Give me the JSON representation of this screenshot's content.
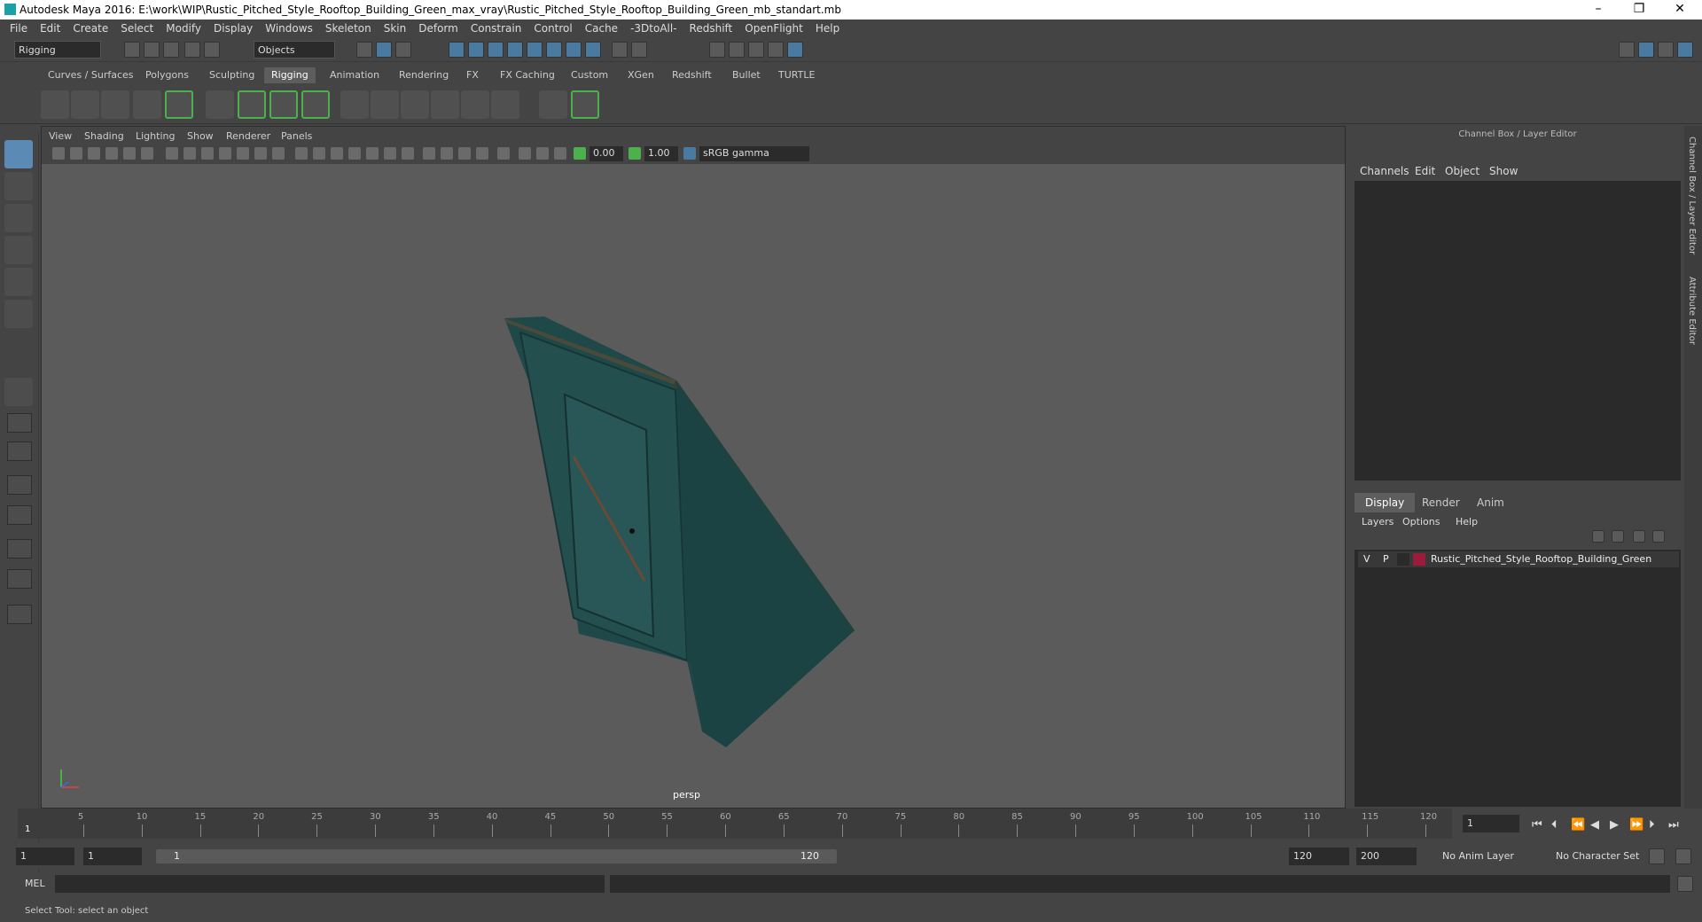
{
  "window": {
    "title": "Autodesk Maya 2016: E:\\work\\WIP\\Rustic_Pitched_Style_Rooftop_Building_Green_max_vray\\Rustic_Pitched_Style_Rooftop_Building_Green_mb_standart.mb",
    "minimize": "–",
    "restore": "❐",
    "close": "✕"
  },
  "menubar": [
    "File",
    "Edit",
    "Create",
    "Select",
    "Modify",
    "Display",
    "Windows",
    "Skeleton",
    "Skin",
    "Deform",
    "Constrain",
    "Control",
    "Cache",
    "-3DtoAll-",
    "Redshift",
    "OpenFlight",
    "Help"
  ],
  "statusline": {
    "mode": "Rigging",
    "selection_mode": "Objects"
  },
  "shelf_tabs": [
    {
      "label": "Curves / Surfaces"
    },
    {
      "label": "Polygons"
    },
    {
      "label": "Sculpting"
    },
    {
      "label": "Rigging",
      "active": true
    },
    {
      "label": "Animation"
    },
    {
      "label": "Rendering"
    },
    {
      "label": "FX"
    },
    {
      "label": "FX Caching"
    },
    {
      "label": "Custom"
    },
    {
      "label": "XGen"
    },
    {
      "label": "Redshift"
    },
    {
      "label": "Bullet"
    },
    {
      "label": "TURTLE"
    }
  ],
  "viewport": {
    "menu": [
      "View",
      "Shading",
      "Lighting",
      "Show",
      "Renderer",
      "Panels"
    ],
    "exposure": "0.00",
    "gamma": "1.00",
    "color_space": "sRGB gamma",
    "camera_label": "persp"
  },
  "channel_box": {
    "title": "Channel Box / Layer Editor",
    "menu": [
      "Channels",
      "Edit",
      "Object",
      "Show"
    ],
    "layer_tabs": [
      "Display",
      "Render",
      "Anim"
    ],
    "layer_menu": [
      "Layers",
      "Options",
      "Help"
    ],
    "layers": [
      {
        "v": "V",
        "p": "P",
        "color": "#9b1c3a",
        "name": "Rustic_Pitched_Style_Rooftop_Building_Green"
      }
    ]
  },
  "side_tabs": [
    "Channel Box / Layer Editor",
    "Attribute Editor"
  ],
  "timeline": {
    "ticks": [
      "5",
      "10",
      "15",
      "20",
      "25",
      "30",
      "35",
      "40",
      "45",
      "50",
      "55",
      "60",
      "65",
      "70",
      "75",
      "80",
      "85",
      "90",
      "95",
      "100",
      "105",
      "110",
      "115",
      "120"
    ],
    "start_label": "1",
    "current_frame": "1"
  },
  "range": {
    "start": "1",
    "playback_start": "1",
    "slider_start": "1",
    "slider_end": "120",
    "playback_end": "120",
    "end": "200",
    "anim_layer": "No Anim Layer",
    "character_set": "No Character Set"
  },
  "command_line": {
    "label": "MEL"
  },
  "help_line": "Select Tool: select an object",
  "colors": {
    "accent": "#5b8ab5",
    "viewport_bg": "#5b5b5b",
    "shelf_active": "#4cb04c",
    "building": "#1f4a4a"
  }
}
